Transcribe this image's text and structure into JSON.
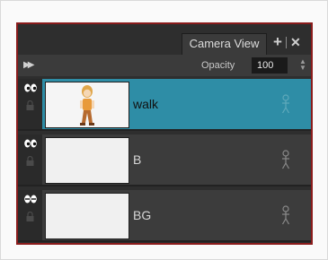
{
  "tab": {
    "label": "Camera View",
    "add_symbol": "+",
    "close_symbol": "✕"
  },
  "toolbar": {
    "opacity_label": "Opacity",
    "opacity_value": "100"
  },
  "layers": [
    {
      "name": "walk",
      "selected": true,
      "visibility": "visible"
    },
    {
      "name": "B",
      "selected": false,
      "visibility": "visible"
    },
    {
      "name": "BG",
      "selected": false,
      "visibility": "visible"
    }
  ],
  "colors": {
    "selection": "#2e8da6",
    "panel": "#2e2e2e",
    "frame_border": "#8a1c1c"
  },
  "icons": [
    "fast-forward-icon",
    "stepper-icon",
    "eye-icon",
    "lock-icon",
    "puppet-icon"
  ]
}
